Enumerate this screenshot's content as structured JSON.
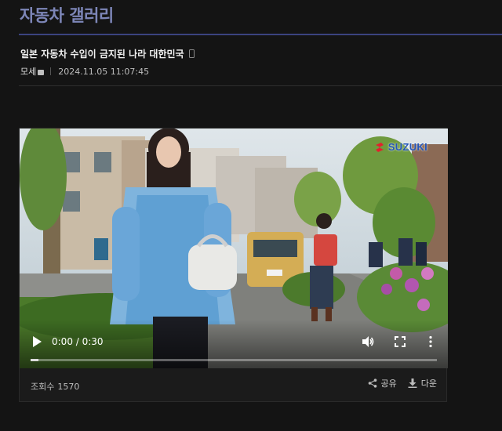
{
  "gallery": {
    "title": "자동차 갤러리"
  },
  "post": {
    "title": "일본 자동차 수입이 금지된 나라 대한민국",
    "author": "모세",
    "date": "2024.11.05 11:07:45",
    "views_label": "조회수",
    "views_count": "1570"
  },
  "video": {
    "brand_text": "SUZUKI",
    "time_display": "0:00 / 0:30",
    "progress": 0.02,
    "icons": [
      "play-icon",
      "volume-icon",
      "fullscreen-icon",
      "more-vert-icon"
    ]
  },
  "actions": {
    "share_label": "공유",
    "download_label": "다운"
  },
  "colors": {
    "accent": "#7d86b8",
    "rule": "#3b4380",
    "background": "#141414",
    "brand": "#e4202e"
  }
}
